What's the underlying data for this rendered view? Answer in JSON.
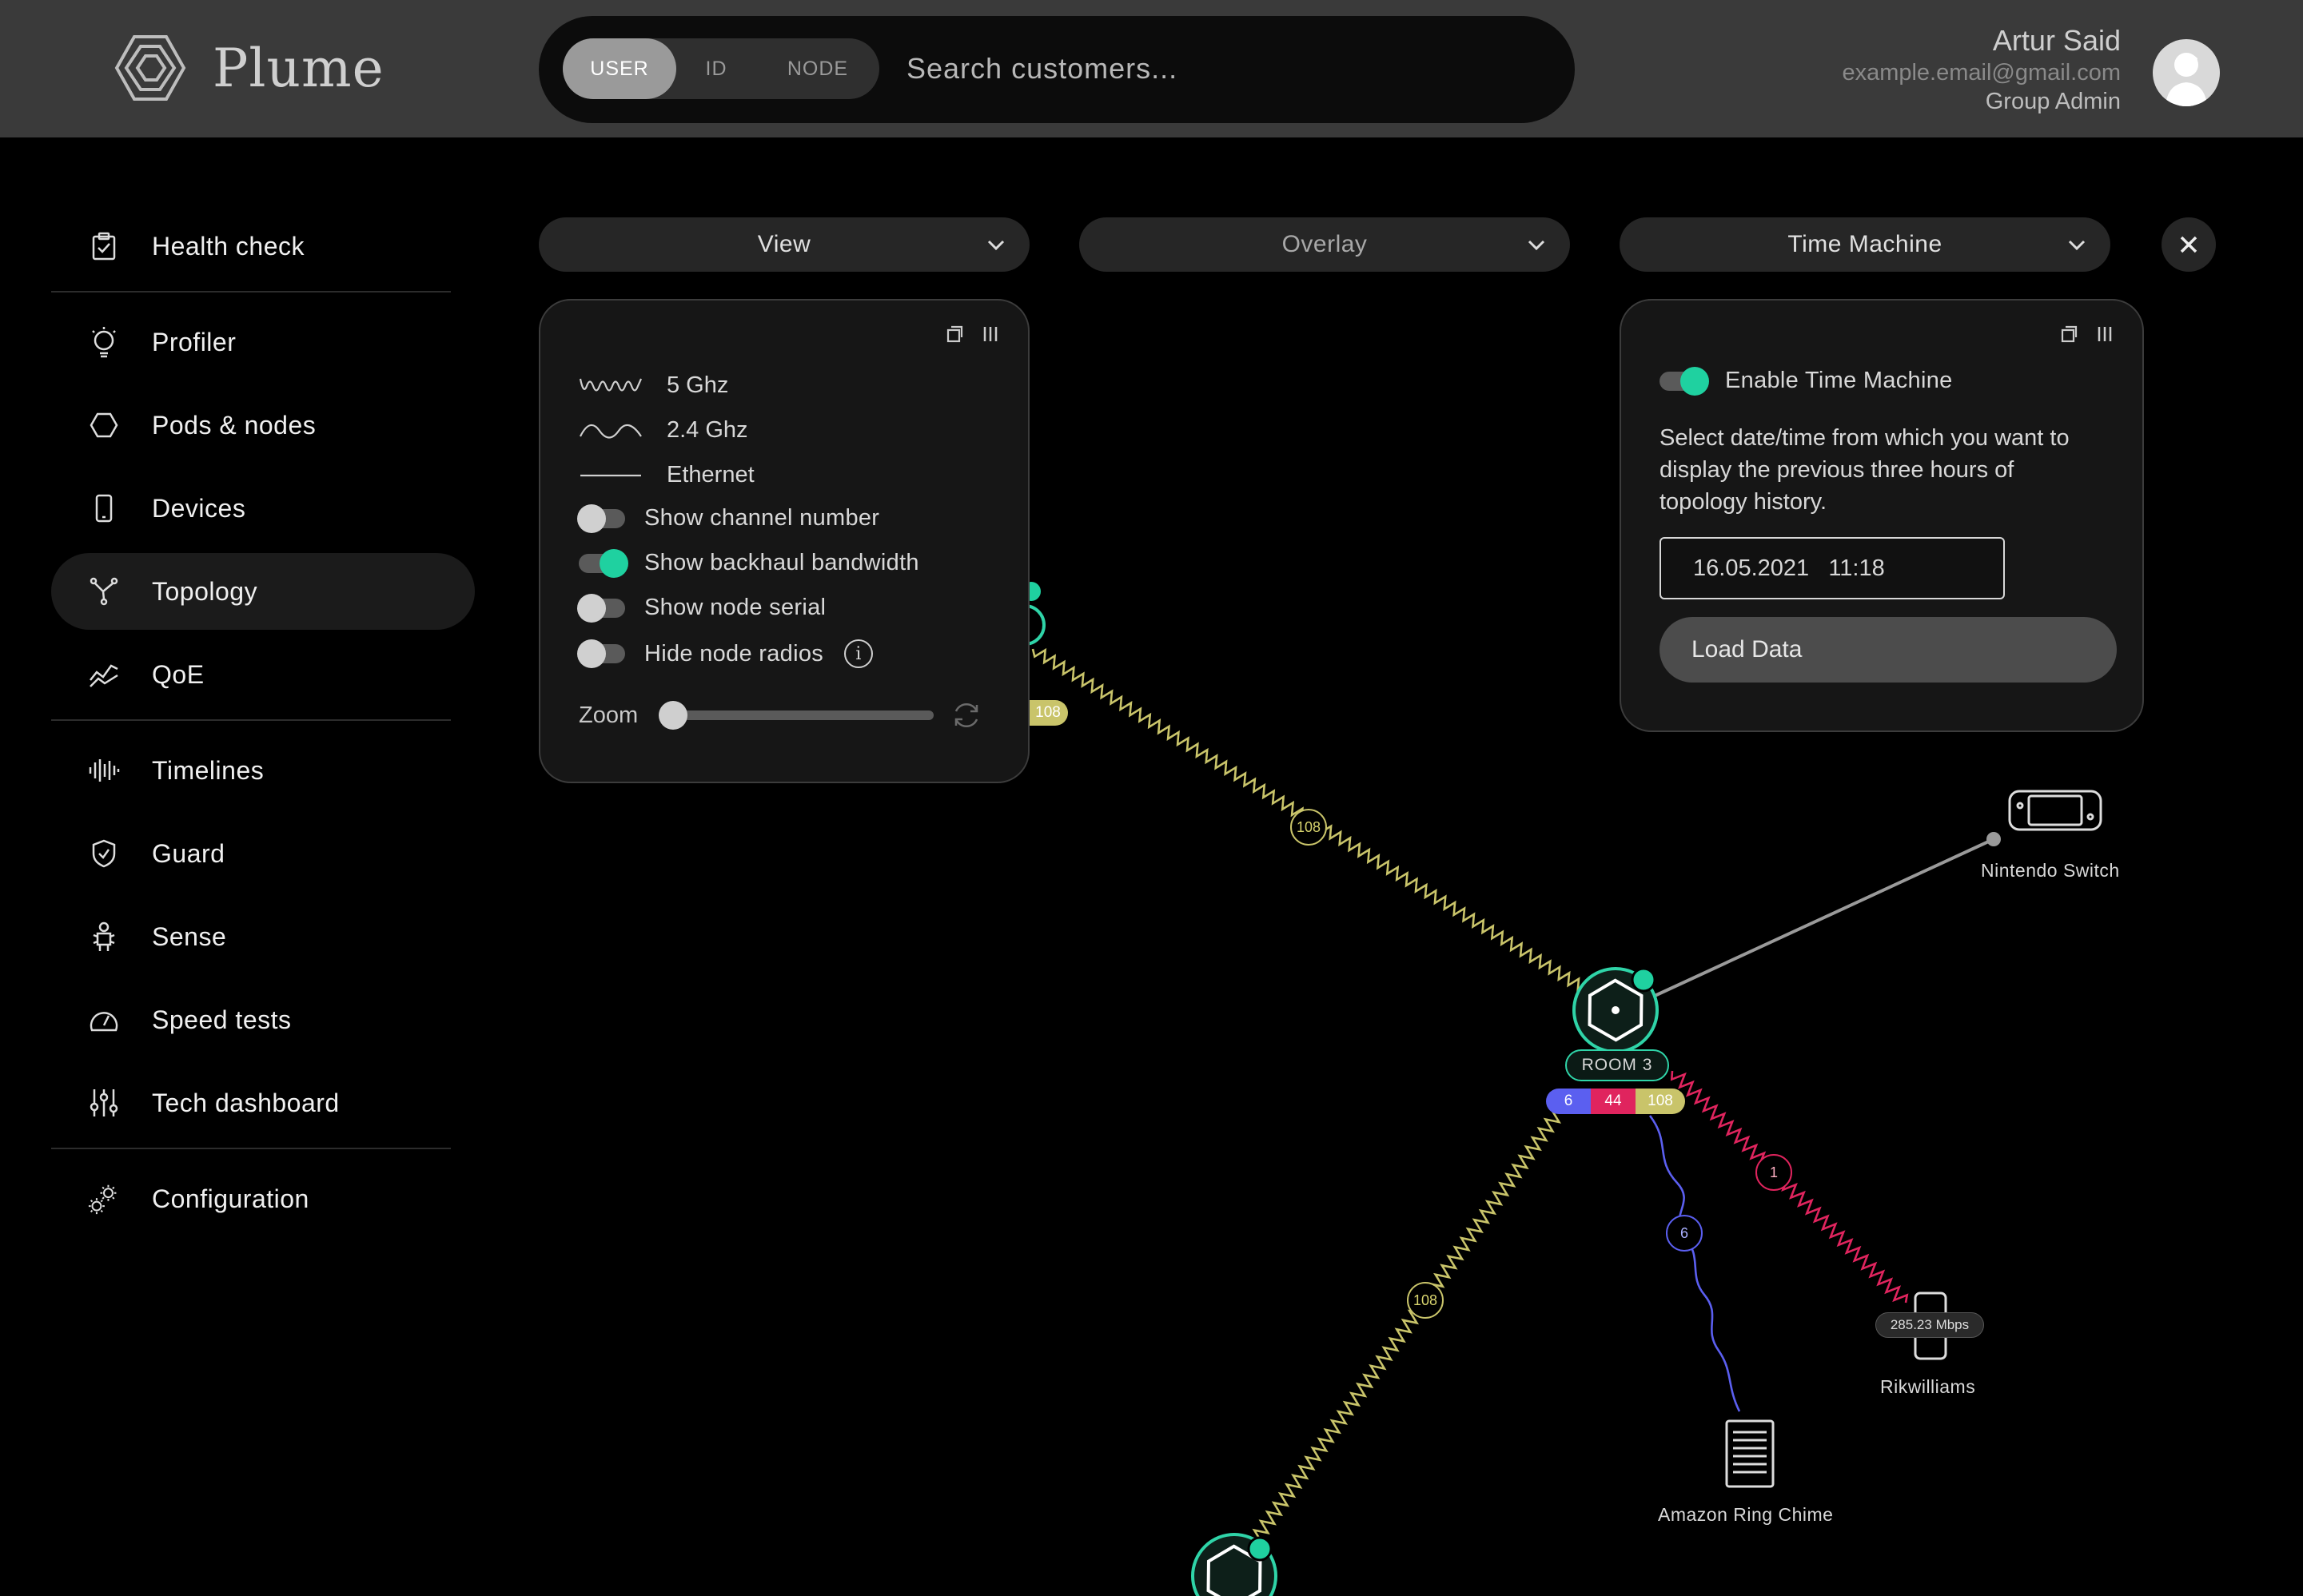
{
  "brand": {
    "name": "Plume"
  },
  "search": {
    "segments": [
      "USER",
      "ID",
      "NODE"
    ],
    "active_segment": "USER",
    "placeholder": "Search customers..."
  },
  "user": {
    "name": "Artur Said",
    "email": "example.email@gmail.com",
    "role": "Group Admin"
  },
  "sidebar": {
    "items": [
      {
        "label": "Health check",
        "icon": "clipboard-check-icon"
      },
      {
        "label": "Profiler",
        "icon": "lightbulb-icon"
      },
      {
        "label": "Pods & nodes",
        "icon": "hexagon-icon"
      },
      {
        "label": "Devices",
        "icon": "phone-icon"
      },
      {
        "label": "Topology",
        "icon": "topology-icon",
        "active": true
      },
      {
        "label": "QoE",
        "icon": "qoe-chart-icon"
      },
      {
        "label": "Timelines",
        "icon": "waveform-icon"
      },
      {
        "label": "Guard",
        "icon": "shield-icon"
      },
      {
        "label": "Sense",
        "icon": "sense-icon"
      },
      {
        "label": "Speed tests",
        "icon": "speedometer-icon"
      },
      {
        "label": "Tech dashboard",
        "icon": "sliders-icon"
      },
      {
        "label": "Configuration",
        "icon": "gears-icon"
      }
    ]
  },
  "toolbar": {
    "view": "View",
    "overlay": "Overlay",
    "time_machine": "Time Machine"
  },
  "view_panel": {
    "legend": [
      {
        "label": "5 Ghz",
        "icon": "wave-5ghz-icon"
      },
      {
        "label": "2.4 Ghz",
        "icon": "wave-24ghz-icon"
      },
      {
        "label": "Ethernet",
        "icon": "ethernet-line-icon"
      }
    ],
    "toggles": [
      {
        "label": "Show channel number",
        "on": false
      },
      {
        "label": "Show backhaul bandwidth",
        "on": true
      },
      {
        "label": "Show node serial",
        "on": false
      },
      {
        "label": "Hide node radios",
        "on": false
      }
    ],
    "zoom_label": "Zoom",
    "zoom_level": 0
  },
  "time_machine_panel": {
    "enable_label": "Enable Time Machine",
    "enabled": true,
    "description": "Select date/time from which you want to display the previous three hours of topology history.",
    "datetime": "16.05.2021   11:18",
    "load_button": "Load Data"
  },
  "topology": {
    "room_label": "ROOM 3",
    "channels": [
      "6",
      "44",
      "108"
    ],
    "partial_channel": "108",
    "link_badges": [
      "108",
      "108",
      "6",
      "1"
    ],
    "speed": "285.23 Mbps",
    "devices": [
      "Nintendo Switch",
      "Rikwilliams",
      "Amazon Ring Chime"
    ]
  },
  "colors": {
    "accent": "#1fd1a0",
    "band_5ghz": "#c9c46a",
    "band_24ghz": "#5b5ff0",
    "band_red": "#e0245e",
    "header_bg": "#3a3a3a"
  }
}
